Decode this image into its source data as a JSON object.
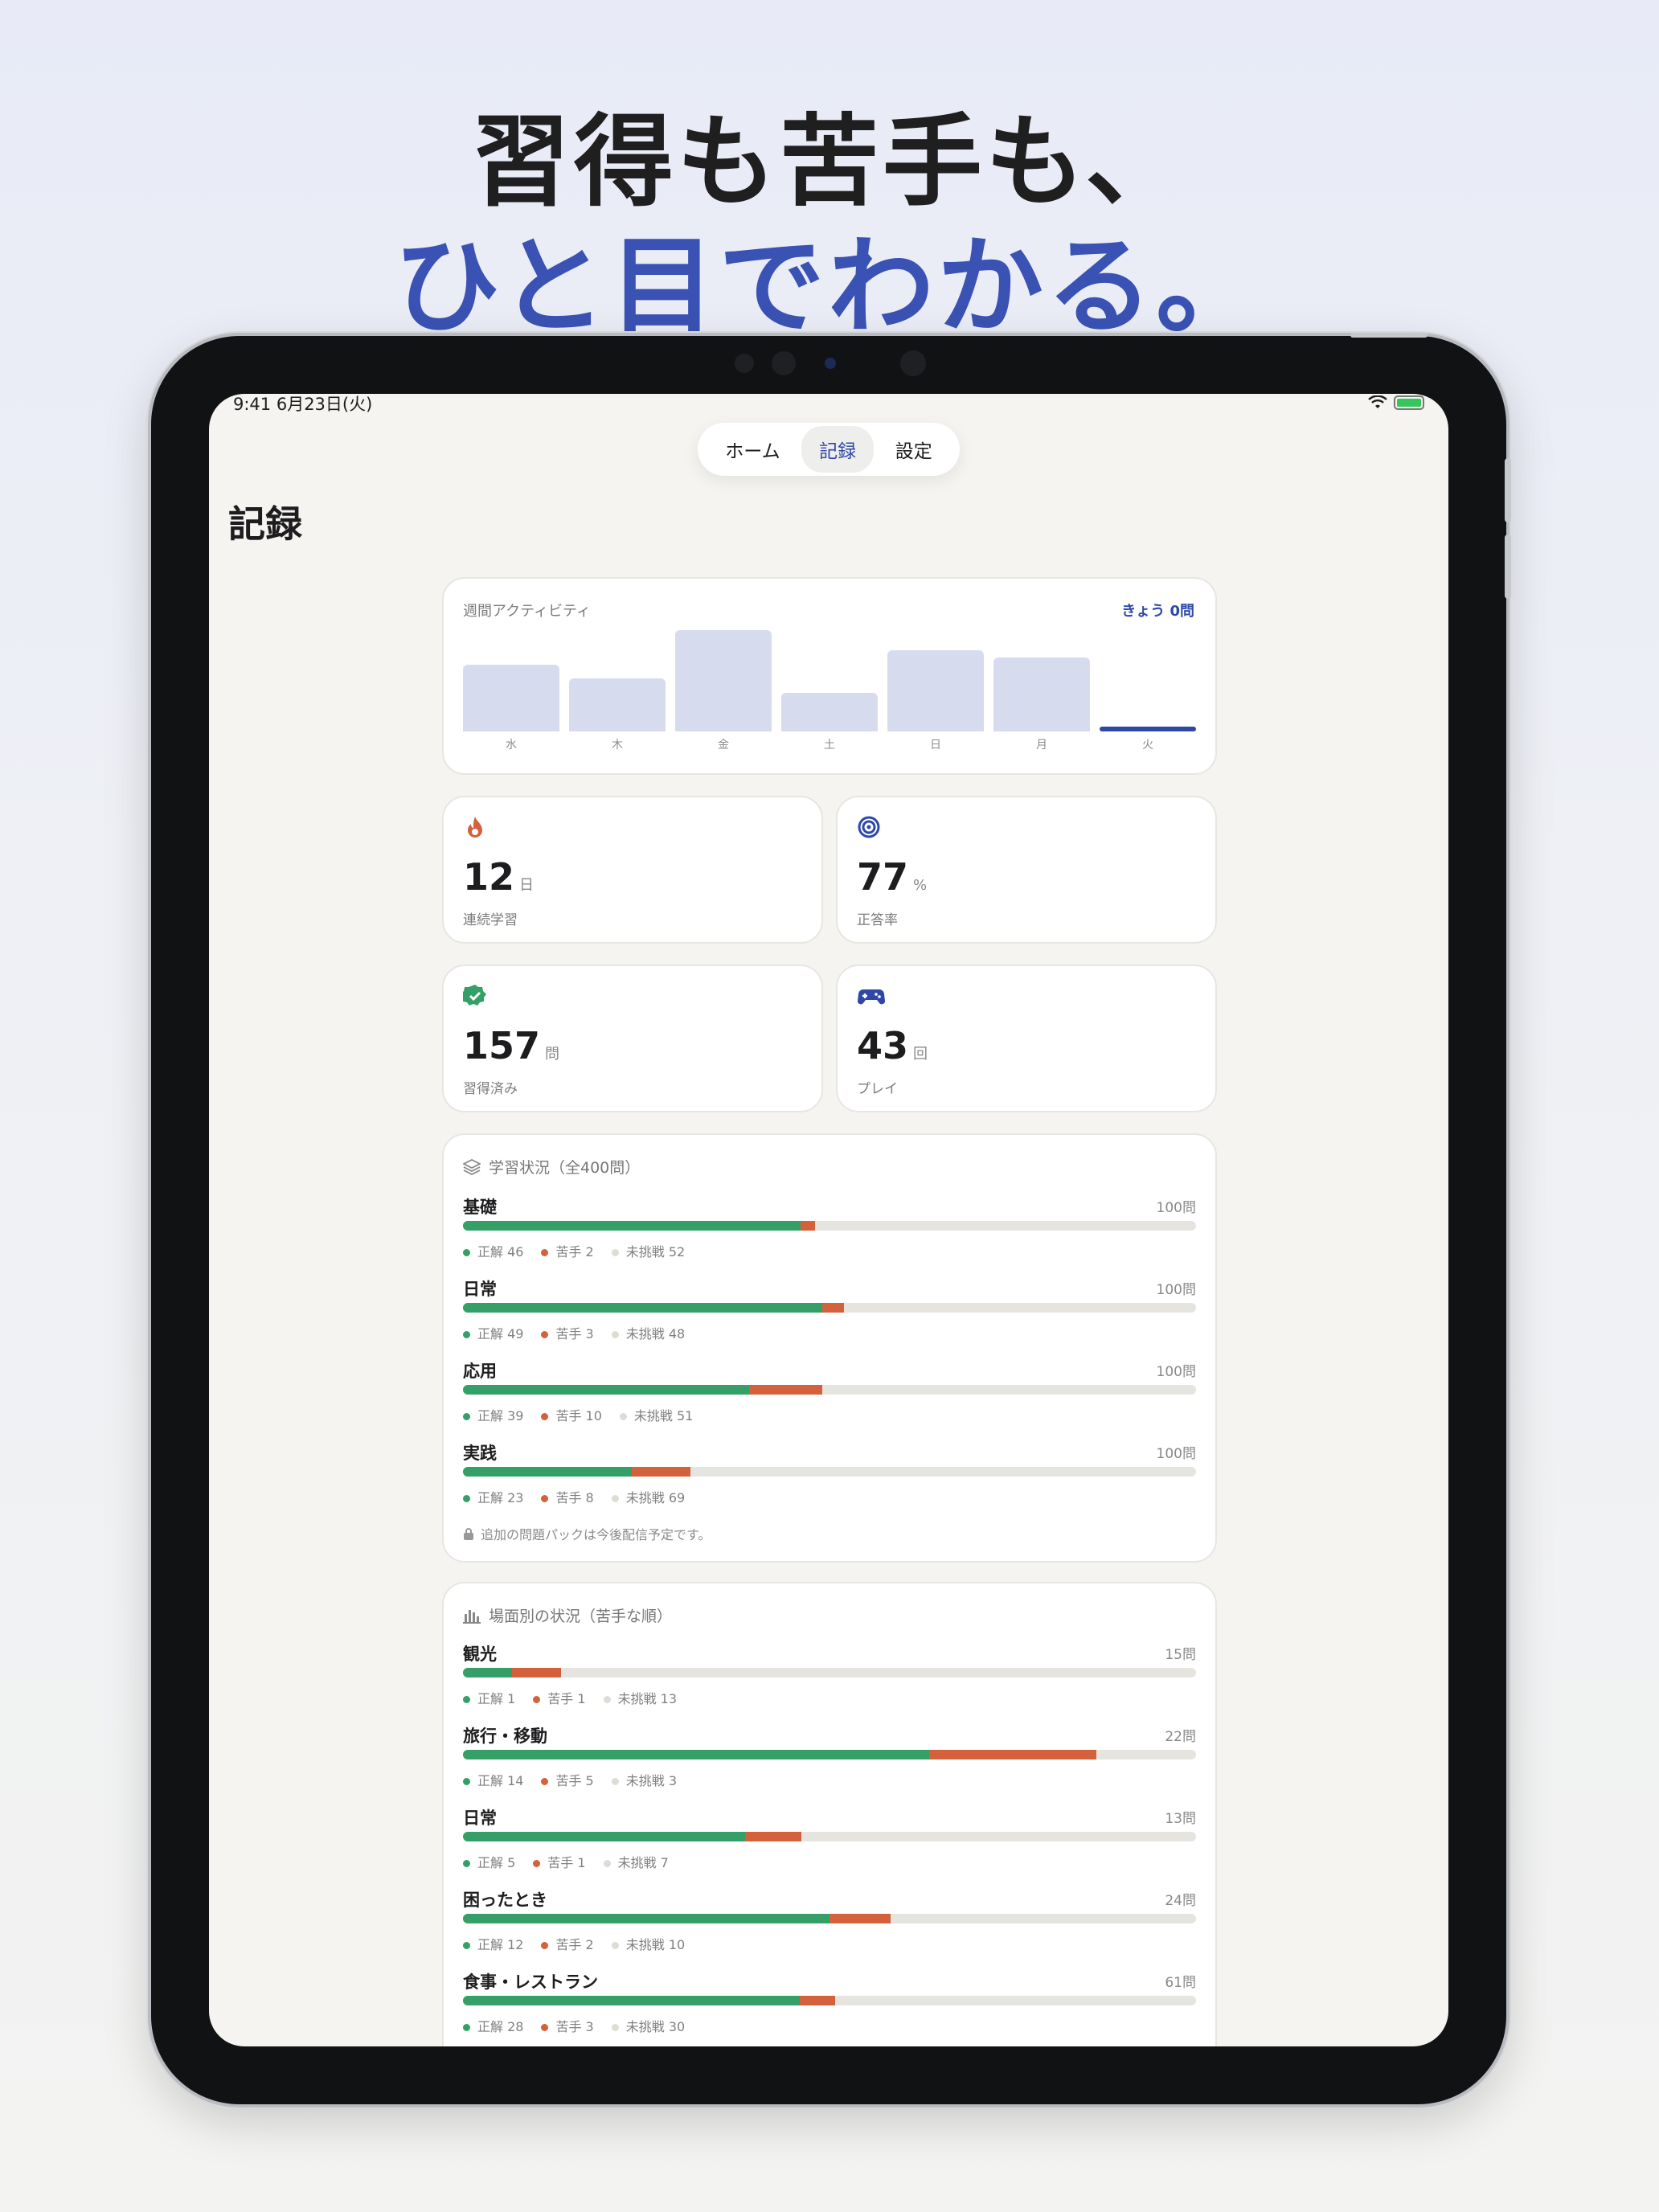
{
  "headline": {
    "line1": "習得も苦手も、",
    "line2": "ひと目でわかる。"
  },
  "status_bar": {
    "time": "9:41  6月23日(火)"
  },
  "tabs": [
    {
      "label": "ホーム",
      "active": false
    },
    {
      "label": "記録",
      "active": true
    },
    {
      "label": "設定",
      "active": false
    }
  ],
  "page_title": "記録",
  "weekly": {
    "title": "週間アクティビティ",
    "today_label": "きょう 0問",
    "days": [
      "水",
      "木",
      "金",
      "土",
      "日",
      "月",
      "火"
    ],
    "levels": [
      0.66,
      0.52,
      1.0,
      0.38,
      0.8,
      0.73,
      0
    ],
    "today_index": 6
  },
  "stats": [
    {
      "icon": "flame-icon",
      "value": "12",
      "unit": "日",
      "label": "連続学習",
      "color": "#d3613b"
    },
    {
      "icon": "target-icon",
      "value": "77",
      "unit": "%",
      "label": "正答率",
      "color": "#2f48a8"
    },
    {
      "icon": "verified-check-icon",
      "value": "157",
      "unit": "問",
      "label": "習得済み",
      "color": "#34a068"
    },
    {
      "icon": "gamepad-icon",
      "value": "43",
      "unit": "回",
      "label": "プレイ",
      "color": "#2f48a8"
    }
  ],
  "progress": {
    "title": "学習状況（全400問）",
    "rows": [
      {
        "name": "基礎",
        "total": "100問",
        "ok": 46,
        "ng": 2,
        "na": 52,
        "max": 100,
        "ok_text": "正解 46",
        "ng_text": "苦手 2",
        "na_text": "未挑戦 52"
      },
      {
        "name": "日常",
        "total": "100問",
        "ok": 49,
        "ng": 3,
        "na": 48,
        "max": 100,
        "ok_text": "正解 49",
        "ng_text": "苦手 3",
        "na_text": "未挑戦 48"
      },
      {
        "name": "応用",
        "total": "100問",
        "ok": 39,
        "ng": 10,
        "na": 51,
        "max": 100,
        "ok_text": "正解 39",
        "ng_text": "苦手 10",
        "na_text": "未挑戦 51"
      },
      {
        "name": "実践",
        "total": "100問",
        "ok": 23,
        "ng": 8,
        "na": 69,
        "max": 100,
        "ok_text": "正解 23",
        "ng_text": "苦手 8",
        "na_text": "未挑戦 69"
      }
    ],
    "footnote": "追加の問題パックは今後配信予定です。"
  },
  "scenes": {
    "title": "場面別の状況（苦手な順）",
    "rows": [
      {
        "name": "観光",
        "total": "15問",
        "ok": 1,
        "ng": 1,
        "na": 13,
        "max": 15,
        "ok_text": "正解 1",
        "ng_text": "苦手 1",
        "na_text": "未挑戦 13"
      },
      {
        "name": "旅行・移動",
        "total": "22問",
        "ok": 14,
        "ng": 5,
        "na": 3,
        "max": 22,
        "ok_text": "正解 14",
        "ng_text": "苦手 5",
        "na_text": "未挑戦 3"
      },
      {
        "name": "日常",
        "total": "13問",
        "ok": 5,
        "ng": 1,
        "na": 7,
        "max": 13,
        "ok_text": "正解 5",
        "ng_text": "苦手 1",
        "na_text": "未挑戦 7"
      },
      {
        "name": "困ったとき",
        "total": "24問",
        "ok": 12,
        "ng": 2,
        "na": 10,
        "max": 24,
        "ok_text": "正解 12",
        "ng_text": "苦手 2",
        "na_text": "未挑戦 10"
      },
      {
        "name": "食事・レストラン",
        "total": "61問",
        "ok": 28,
        "ng": 3,
        "na": 30,
        "max": 61,
        "ok_text": "正解 28",
        "ng_text": "苦手 3",
        "na_text": "未挑戦 30"
      }
    ]
  }
}
